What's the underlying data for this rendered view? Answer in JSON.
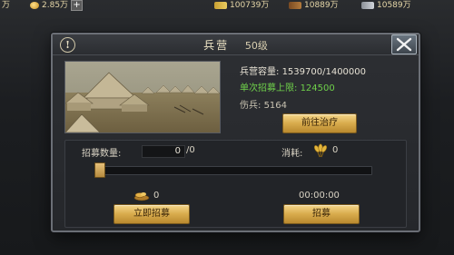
{
  "topbar": {
    "left_amount": "万",
    "gold_amount": "2.85万",
    "res1": "100739万",
    "res2": "10889万",
    "res3": "10589万"
  },
  "dialog": {
    "title": "兵营",
    "level": "50级",
    "capacity_label": "兵营容量:",
    "capacity_value": "1539700/1400000",
    "recruit_limit_label": "单次招募上限:",
    "recruit_limit_value": "124500",
    "wounded_label": "伤兵:",
    "wounded_value": "5164",
    "heal_button": "前往治疗",
    "recruit_qty_label": "招募数量:",
    "recruit_qty_value": "0",
    "recruit_qty_max": "/0",
    "cost_label": "消耗:",
    "cost_value": "0",
    "food_value": "0",
    "timer": "00:00:00",
    "instant_recruit_button": "立即招募",
    "recruit_button": "招募"
  },
  "slider": {
    "fraction": 0.0
  },
  "icons": [
    "coin-icon",
    "plus-icon",
    "wheat-icon",
    "wood-icon",
    "iron-icon",
    "info-icon",
    "close-icon",
    "food-icon"
  ],
  "colors": {
    "accent_gold": "#d8ab4c",
    "limit_green": "#6fd14a",
    "panel": "#2d2f33"
  }
}
